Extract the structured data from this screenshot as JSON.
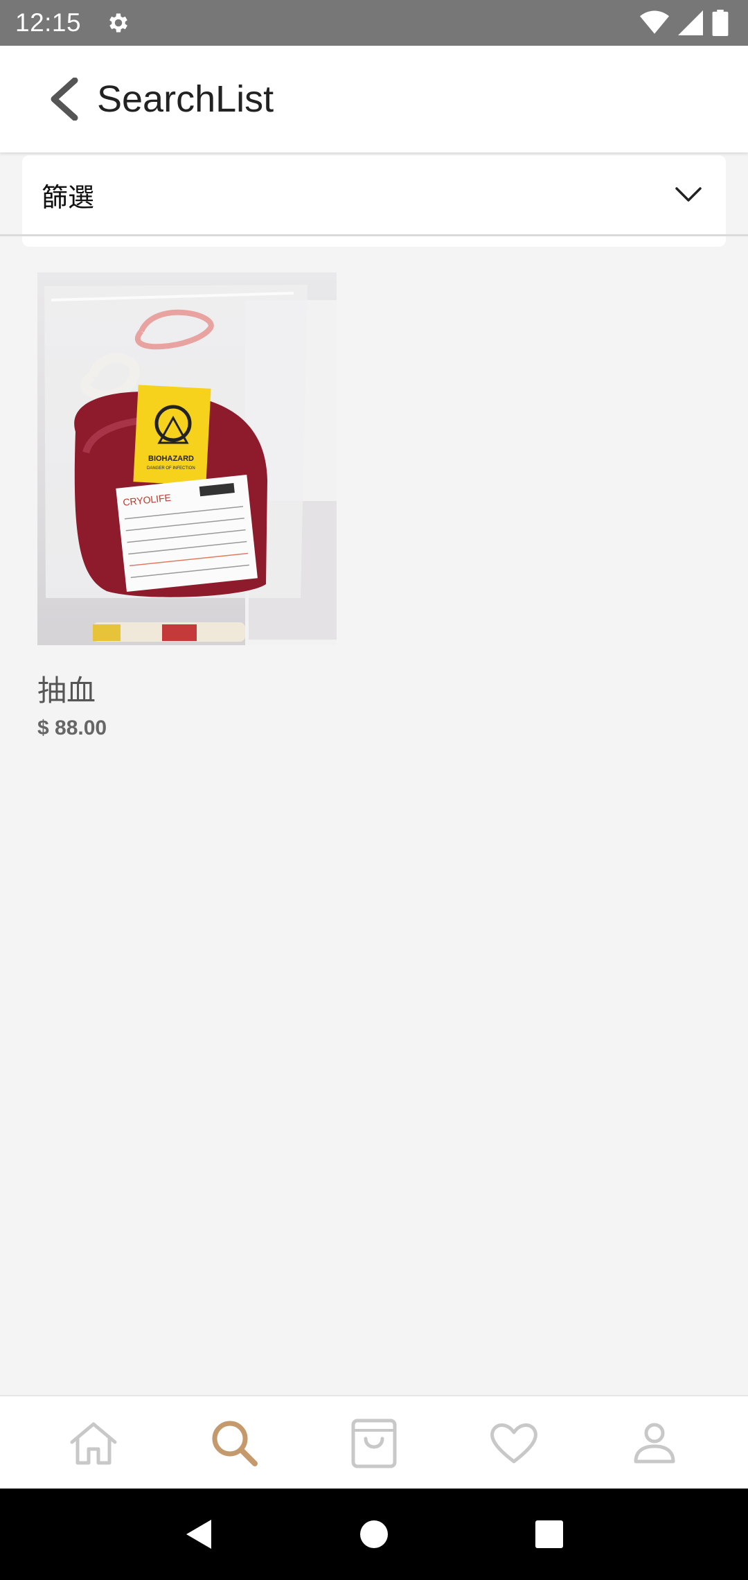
{
  "status_bar": {
    "time": "12:15",
    "icons": [
      "gear-icon",
      "wifi-icon",
      "signal-icon",
      "battery-icon"
    ]
  },
  "app_bar": {
    "title": "SearchList",
    "back_icon": "chevron-left-icon"
  },
  "filter": {
    "label": "篩選",
    "icon": "chevron-down-icon"
  },
  "products": [
    {
      "name": "抽血",
      "price": "$ 88.00",
      "image_labels": {
        "hazard": "BIOHAZARD",
        "hazard_sub": "DANGER OF INFECTION",
        "brand": "CRYOLIFE"
      }
    }
  ],
  "bottom_nav": {
    "items": [
      {
        "icon": "home-icon",
        "active": false
      },
      {
        "icon": "search-icon",
        "active": true
      },
      {
        "icon": "shopping-bag-icon",
        "active": false
      },
      {
        "icon": "heart-icon",
        "active": false
      },
      {
        "icon": "profile-icon",
        "active": false
      }
    ],
    "active_color": "#c49a6c",
    "inactive_color": "#c8c8c8"
  },
  "system_nav": {
    "items": [
      "back-triangle-icon",
      "home-circle-icon",
      "recents-square-icon"
    ]
  }
}
